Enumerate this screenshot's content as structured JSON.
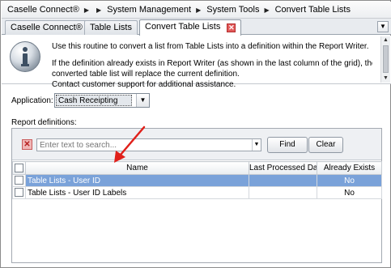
{
  "breadcrumb": {
    "items": [
      "Caselle Connect®",
      "System Management",
      "System Tools",
      "Convert Table Lists"
    ],
    "separator": "▶"
  },
  "tabs": [
    {
      "label": "Caselle Connect®"
    },
    {
      "label": "Table Lists"
    },
    {
      "label": "Convert Table Lists",
      "active": true,
      "closable": true
    }
  ],
  "tab_close_glyph": "✕",
  "tab_menu_glyph": "▼",
  "info": {
    "line1": "Use this routine to convert a list from Table Lists into a definition within the Report Writer.",
    "line2": "If the definition already exists in Report Writer (as shown in the last column of the grid), the newly",
    "line3": "converted table list will replace the current definition.",
    "line4": "Contact customer support for additional assistance."
  },
  "application": {
    "label": "Application:",
    "selected": "Cash Receipting"
  },
  "report_definitions_label": "Report definitions:",
  "search": {
    "placeholder": "Enter text to search...",
    "value": ""
  },
  "toolbar": {
    "find_label": "Find",
    "clear_label": "Clear"
  },
  "grid": {
    "columns": [
      "Name",
      "Last Processed Date",
      "Already Exists"
    ],
    "rows": [
      {
        "name": "Table Lists - User ID",
        "last_processed": "",
        "exists": "No",
        "selected": true
      },
      {
        "name": "Table Lists - User ID Labels",
        "last_processed": "",
        "exists": "No",
        "selected": false
      }
    ]
  },
  "colors": {
    "selection": "#7aa2d9",
    "annotation_arrow": "#e0201a",
    "info_icon": "#4a78b0"
  },
  "icons": [
    "info-icon",
    "close-icon",
    "chevron-down-icon",
    "clear-search-icon",
    "arrow-annotation"
  ]
}
